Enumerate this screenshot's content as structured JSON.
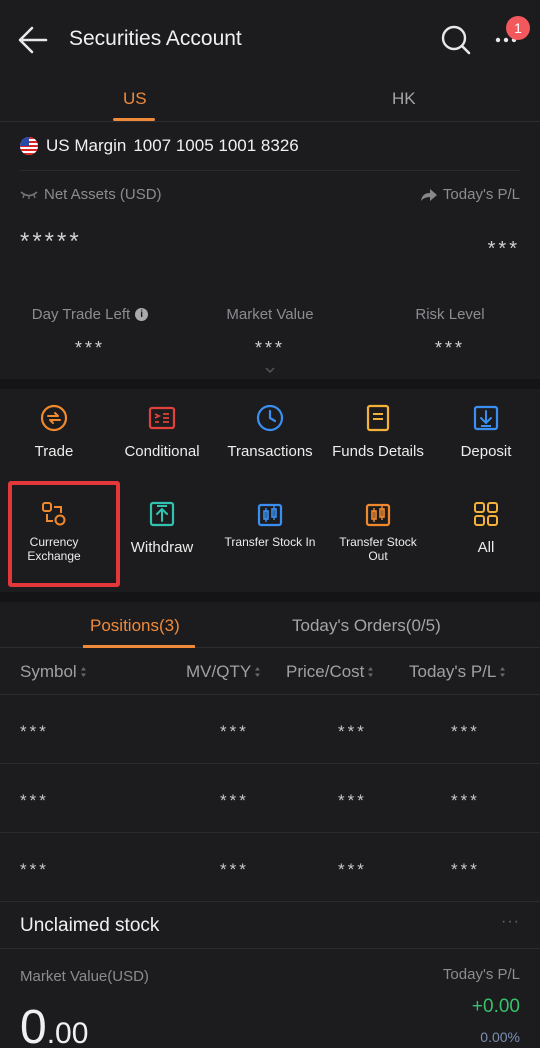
{
  "header": {
    "title": "Securities Account",
    "notification_count": "1"
  },
  "market_tabs": [
    {
      "label": "US",
      "active": true
    },
    {
      "label": "HK",
      "active": false
    }
  ],
  "account": {
    "name": "US Margin",
    "number": "1007 1005 1001 8326"
  },
  "summary": {
    "net_assets_label": "Net Assets (USD)",
    "net_assets_value": "*****",
    "todays_pl_label": "Today's P/L",
    "todays_pl_value": "***",
    "stats": [
      {
        "label": "Day Trade Left",
        "value": "***"
      },
      {
        "label": "Market Value",
        "value": "***"
      },
      {
        "label": "Risk Level",
        "value": "***"
      }
    ]
  },
  "actions": [
    {
      "label": "Trade",
      "icon": "trade-icon",
      "color": "#f0892d"
    },
    {
      "label": "Conditional",
      "icon": "conditional-icon",
      "color": "#e0413a"
    },
    {
      "label": "Transactions",
      "icon": "clock-icon",
      "color": "#3a8ff0"
    },
    {
      "label": "Funds Details",
      "icon": "document-icon",
      "color": "#f2b23a"
    },
    {
      "label": "Deposit",
      "icon": "deposit-icon",
      "color": "#3a8ff0"
    },
    {
      "label": "Currency Exchange",
      "icon": "exchange-icon",
      "color": "#f0892d"
    },
    {
      "label": "Withdraw",
      "icon": "withdraw-icon",
      "color": "#2fc3b0"
    },
    {
      "label": "Transfer Stock In",
      "icon": "transfer-in-icon",
      "color": "#3a8ff0"
    },
    {
      "label": "Transfer Stock Out",
      "icon": "transfer-out-icon",
      "color": "#f0892d"
    },
    {
      "label": "All",
      "icon": "grid-icon",
      "color": "#f2b23a"
    }
  ],
  "position_tabs": [
    {
      "label": "Positions(3)",
      "active": true
    },
    {
      "label": "Today's Orders(0/5)",
      "active": false
    }
  ],
  "columns": [
    "Symbol",
    "MV/QTY",
    "Price/Cost",
    "Today's P/L"
  ],
  "rows": [
    [
      "***",
      "***",
      "***",
      "***"
    ],
    [
      "***",
      "***",
      "***",
      "***"
    ],
    [
      "***",
      "***",
      "***",
      "***"
    ]
  ],
  "unclaimed": {
    "title": "Unclaimed stock",
    "more": "···",
    "market_value_label": "Market Value(USD)",
    "market_value_int": "0",
    "market_value_dec": ".00",
    "todays_pl_label": "Today's P/L",
    "todays_pl_value": "+0.00",
    "todays_pl_pct": "0.00%"
  },
  "colors": {
    "accent": "#f08a3b",
    "highlight_box": "#e4373a",
    "positive": "#35c26a"
  }
}
